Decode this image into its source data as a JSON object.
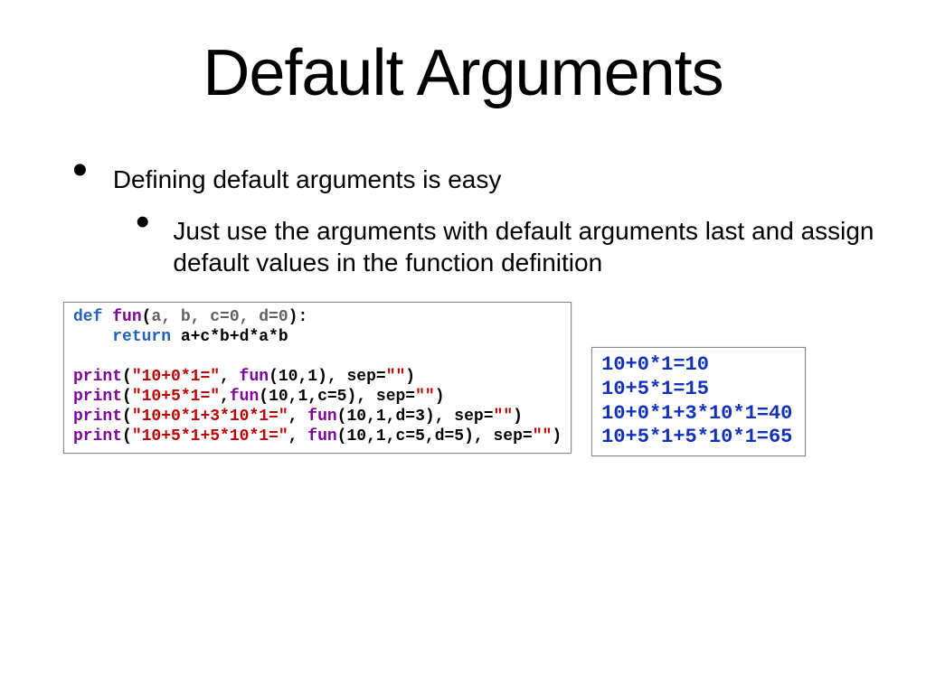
{
  "title": "Default Arguments",
  "bullet1": "Defining default arguments is easy",
  "bullet2": "Just use the arguments with default arguments last and assign default values in the function definition",
  "code": {
    "def": "def",
    "fname": "fun",
    "sig_open": "(",
    "sig_args": "a, b, c=0, d=0",
    "sig_close": "):",
    "ret": "return",
    "expr": " a+c*b+d*a*b",
    "p1a": "print",
    "p1s": "\"10+0*1=\"",
    "p1c": ", ",
    "p1f": "fun",
    "p1args": "(10,1)",
    "p1sep": ", sep=",
    "p1sepv": "\"\"",
    "p1end": ")",
    "p2a": "print",
    "p2s": "\"10+5*1=\"",
    "p2c": ",",
    "p2f": "fun",
    "p2args": "(10,1,c=5)",
    "p2sep": ", sep=",
    "p2sepv": "\"\"",
    "p2end": ")",
    "p3a": "print",
    "p3s": "\"10+0*1+3*10*1=\"",
    "p3c": ", ",
    "p3f": "fun",
    "p3args": "(10,1,d=3)",
    "p3sep": ", sep=",
    "p3sepv": "\"\"",
    "p3end": ")",
    "p4a": "print",
    "p4s": "\"10+5*1+5*10*1=\"",
    "p4c": ", ",
    "p4f": "fun",
    "p4args": "(10,1,c=5,d=5)",
    "p4sep": ", sep=",
    "p4sepv": "\"\"",
    "p4end": ")"
  },
  "output": {
    "l1": "10+0*1=10",
    "l2": "10+5*1=15",
    "l3": "10+0*1+3*10*1=40",
    "l4": "10+5*1+5*10*1=65"
  }
}
